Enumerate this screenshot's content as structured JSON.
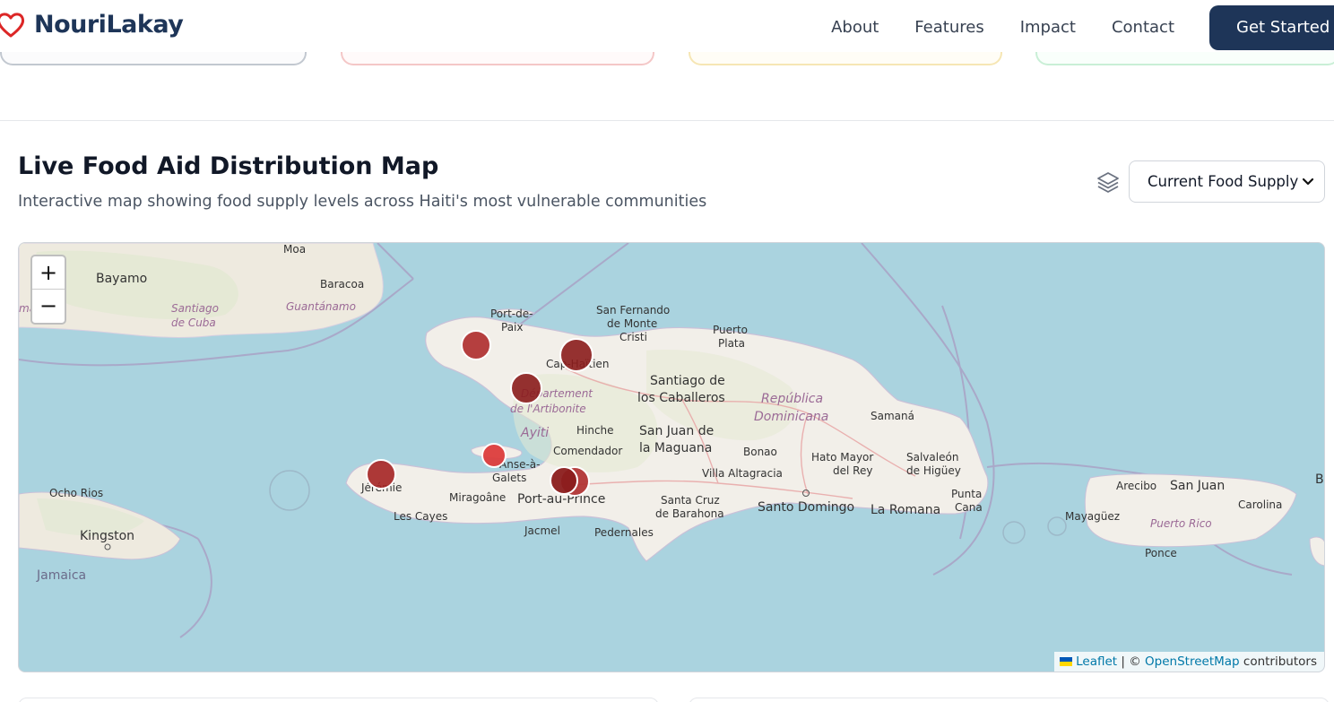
{
  "brand": {
    "name": "NouriLakay",
    "icon": "heart-icon"
  },
  "nav": {
    "links": [
      "About",
      "Features",
      "Impact",
      "Contact"
    ],
    "cta": "Get Started"
  },
  "section": {
    "title": "Live Food Aid Distribution Map",
    "subtitle": "Interactive map showing food supply levels across Haiti's most vulnerable communities",
    "layer_icon": "layers-icon",
    "select_value": "Current Food Supply"
  },
  "map": {
    "zoom_in": "+",
    "zoom_out": "−",
    "attribution": {
      "leaflet": "Leaflet",
      "sep": " | © ",
      "osm": "OpenStreetMap",
      "suffix": " contributors"
    },
    "labels": {
      "moa": "Moa",
      "bayamo": "Bayamo",
      "baracoa": "Baracoa",
      "santiago_cuba_1": "Santiago",
      "santiago_cuba_2": "de Cuba",
      "guantanamo": "Guantánamo",
      "ma": "ma",
      "port_de_paix_1": "Port-de-",
      "port_de_paix_2": "Paix",
      "san_fernando_1": "San Fernando",
      "san_fernando_2": "de Monte",
      "san_fernando_3": "Cristi",
      "puerto_plata_1": "Puerto",
      "puerto_plata_2": "Plata",
      "cap_haitien": "Cap-Haïtien",
      "santiago_cab_1": "Santiago de",
      "santiago_cab_2": "los Caballeros",
      "artibonite_1": "Département",
      "artibonite_2": "de l'Artibonite",
      "republica_1": "República",
      "republica_2": "Dominicana",
      "samana": "Samaná",
      "ayiti": "Ayiti",
      "hinche": "Hinche",
      "san_juan_1": "San Juan de",
      "san_juan_2": "la Maguana",
      "comendador": "Comendador",
      "bonao": "Bonao",
      "hato_mayor_1": "Hato Mayor",
      "hato_mayor_2": "del Rey",
      "salvaleon_1": "Salvaleón",
      "salvaleon_2": "de Higüey",
      "villa_altagracia": "Villa Altagracia",
      "anse_1": "Anse-à-",
      "anse_2": "Galets",
      "jeremie": "Jérémie",
      "miragoane": "Miragoâne",
      "port_au_prince": "Port-au-Prince",
      "santa_cruz_1": "Santa Cruz",
      "santa_cruz_2": "de Barahona",
      "santo_domingo": "Santo Domingo",
      "la_romana": "La Romana",
      "punta_cana_1": "Punta",
      "punta_cana_2": "Cana",
      "les_cayes": "Les Cayes",
      "jacmel": "Jacmel",
      "pedernales": "Pedernales",
      "ocho_rios": "Ocho Rios",
      "kingston": "Kingston",
      "jamaica": "Jamaica",
      "arecibo": "Arecibo",
      "san_juan_pr": "San Juan",
      "carolina": "Carolina",
      "mayaguez": "Mayagüez",
      "puerto_rico": "Puerto Rico",
      "ponce": "Ponce",
      "b": "B"
    }
  },
  "colors": {
    "navy": "#1e3558",
    "marker_dark": "#8b1c1c",
    "marker_mid": "#b03030",
    "marker_light": "#dc3c3c",
    "water": "#aad3df",
    "land": "#f2efe9"
  }
}
